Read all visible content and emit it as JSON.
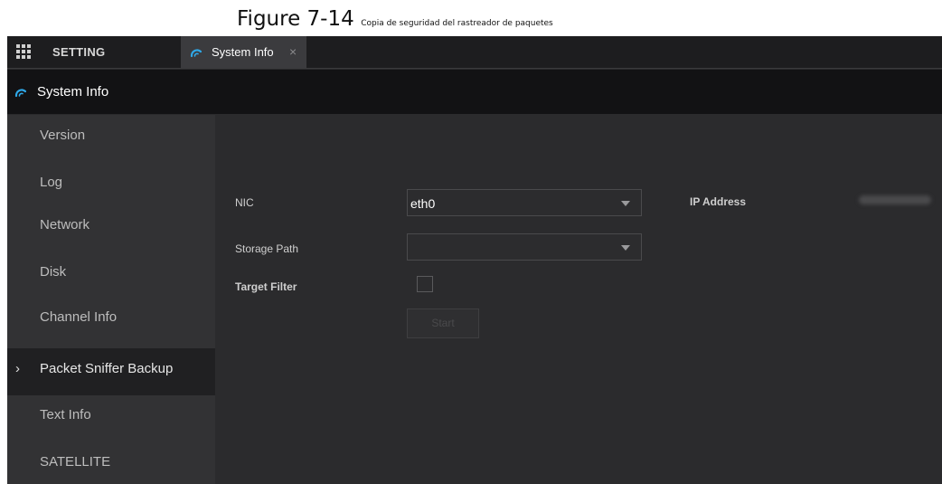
{
  "caption": {
    "figure": "Figure 7-14",
    "description": "Copia de seguridad del rastreador de paquetes"
  },
  "topbar": {
    "menu_icon": "grid-menu-icon",
    "setting_label": "SETTING",
    "tab": {
      "icon": "system-info-icon",
      "label": "System Info",
      "close": "×"
    }
  },
  "subheader": {
    "icon": "system-info-icon",
    "title": "System Info"
  },
  "sidebar": {
    "items": [
      {
        "label": "Version",
        "active": false
      },
      {
        "label": "Log",
        "active": false
      },
      {
        "label": "Network",
        "active": false
      },
      {
        "label": "Disk",
        "active": false
      },
      {
        "label": "Channel Info",
        "active": false
      },
      {
        "label": "Packet Sniffer Backup",
        "active": true
      },
      {
        "label": "Text Info",
        "active": false
      },
      {
        "label": "SATELLITE",
        "active": false
      }
    ],
    "active_marker": "›"
  },
  "form": {
    "nic_label": "NIC",
    "nic_value": "eth0",
    "storage_label": "Storage Path",
    "storage_value": "",
    "target_label": "Target Filter",
    "start_label": "Start",
    "ip_label": "IP Address"
  },
  "colors": {
    "accent": "#2fa8e8",
    "background": "#2b2b2d",
    "sidebar": "#323234",
    "header": "#121214"
  }
}
